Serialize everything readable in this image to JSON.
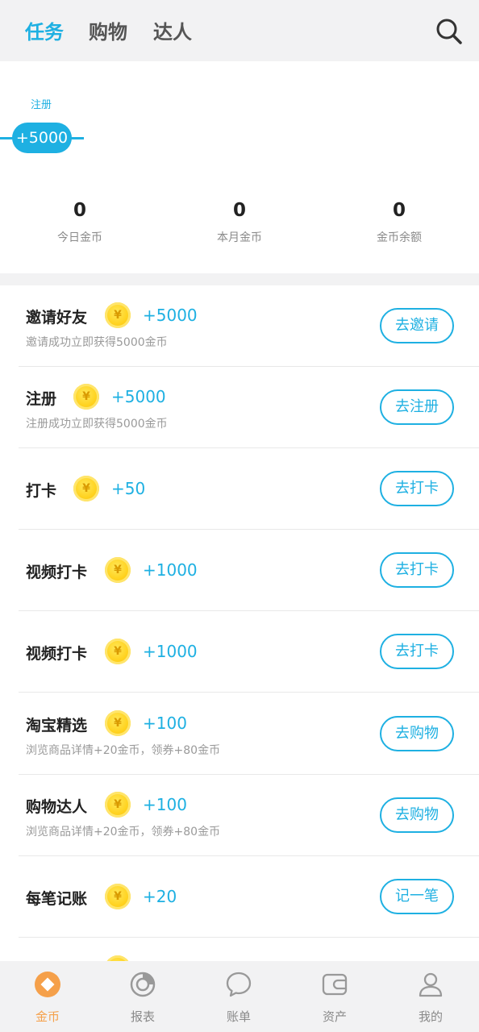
{
  "header": {
    "tabs": [
      {
        "label": "任务"
      },
      {
        "label": "购物"
      },
      {
        "label": "达人"
      }
    ],
    "active_tab": "任务"
  },
  "progress": {
    "step_label": "注册",
    "step_reward": "+5000"
  },
  "stats": [
    {
      "value": "0",
      "label": "今日金币"
    },
    {
      "value": "0",
      "label": "本月金币"
    },
    {
      "value": "0",
      "label": "金币余额"
    }
  ],
  "coin_symbol": "¥",
  "tasks": [
    {
      "title": "邀请好友",
      "reward": "+5000",
      "desc": "邀请成功立即获得5000金币",
      "button": "去邀请"
    },
    {
      "title": "注册",
      "reward": "+5000",
      "desc": "注册成功立即获得5000金币",
      "button": "去注册"
    },
    {
      "title": "打卡",
      "reward": "+50",
      "desc": "",
      "button": "去打卡"
    },
    {
      "title": "视频打卡",
      "reward": "+1000",
      "desc": "",
      "button": "去打卡"
    },
    {
      "title": "视频打卡",
      "reward": "+1000",
      "desc": "",
      "button": "去打卡"
    },
    {
      "title": "淘宝精选",
      "reward": "+100",
      "desc": "浏览商品详情+20金币，领券+80金币",
      "button": "去购物"
    },
    {
      "title": "购物达人",
      "reward": "+100",
      "desc": "浏览商品详情+20金币，领券+80金币",
      "button": "去购物"
    },
    {
      "title": "每笔记账",
      "reward": "+20",
      "desc": "",
      "button": "记一笔"
    }
  ],
  "bottom_nav": [
    {
      "label": "金币",
      "icon": "coin-diamond-icon",
      "active": true
    },
    {
      "label": "报表",
      "icon": "pie-chart-icon",
      "active": false
    },
    {
      "label": "账单",
      "icon": "chat-bubble-icon",
      "active": false
    },
    {
      "label": "资产",
      "icon": "wallet-icon",
      "active": false
    },
    {
      "label": "我的",
      "icon": "user-icon",
      "active": false
    }
  ],
  "colors": {
    "accent": "#1eb0e2",
    "nav_active": "#f5a04a",
    "coin": "#ffd21f"
  }
}
